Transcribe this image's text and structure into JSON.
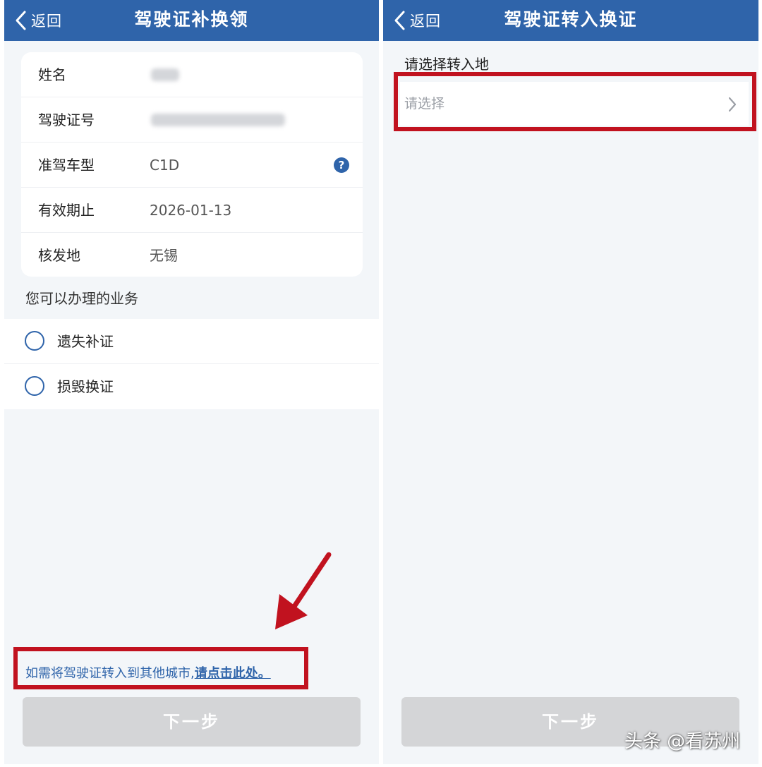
{
  "left": {
    "back_label": "返回",
    "title": "驾驶证补换领",
    "info_rows": [
      {
        "label": "姓名",
        "value": ""
      },
      {
        "label": "驾驶证号",
        "value": ""
      },
      {
        "label": "准驾车型",
        "value": "C1D"
      },
      {
        "label": "有效期止",
        "value": "2026-01-13"
      },
      {
        "label": "核发地",
        "value": "无锡"
      }
    ],
    "section_title": "您可以办理的业务",
    "options": [
      {
        "label": "遗失补证",
        "selected": false
      },
      {
        "label": "损毁换证",
        "selected": false
      }
    ],
    "transfer_text": "如需将驾驶证转入到其他城市,",
    "transfer_link": "请点击此处。",
    "next_button": "下一步"
  },
  "right": {
    "back_label": "返回",
    "title": "驾驶证转入换证",
    "select_label": "请选择转入地",
    "select_placeholder": "请选择",
    "next_button": "下一步"
  },
  "watermark": "头条 @看苏州",
  "colors": {
    "header": "#2f64aa",
    "highlight": "#c1121f",
    "background": "#f3f6f9",
    "button_disabled": "#d4d5d7"
  },
  "icons": {
    "back": "chevron-left-icon",
    "help": "question-circle-icon",
    "select_arrow": "chevron-right-icon",
    "annotation": "arrow-icon"
  }
}
